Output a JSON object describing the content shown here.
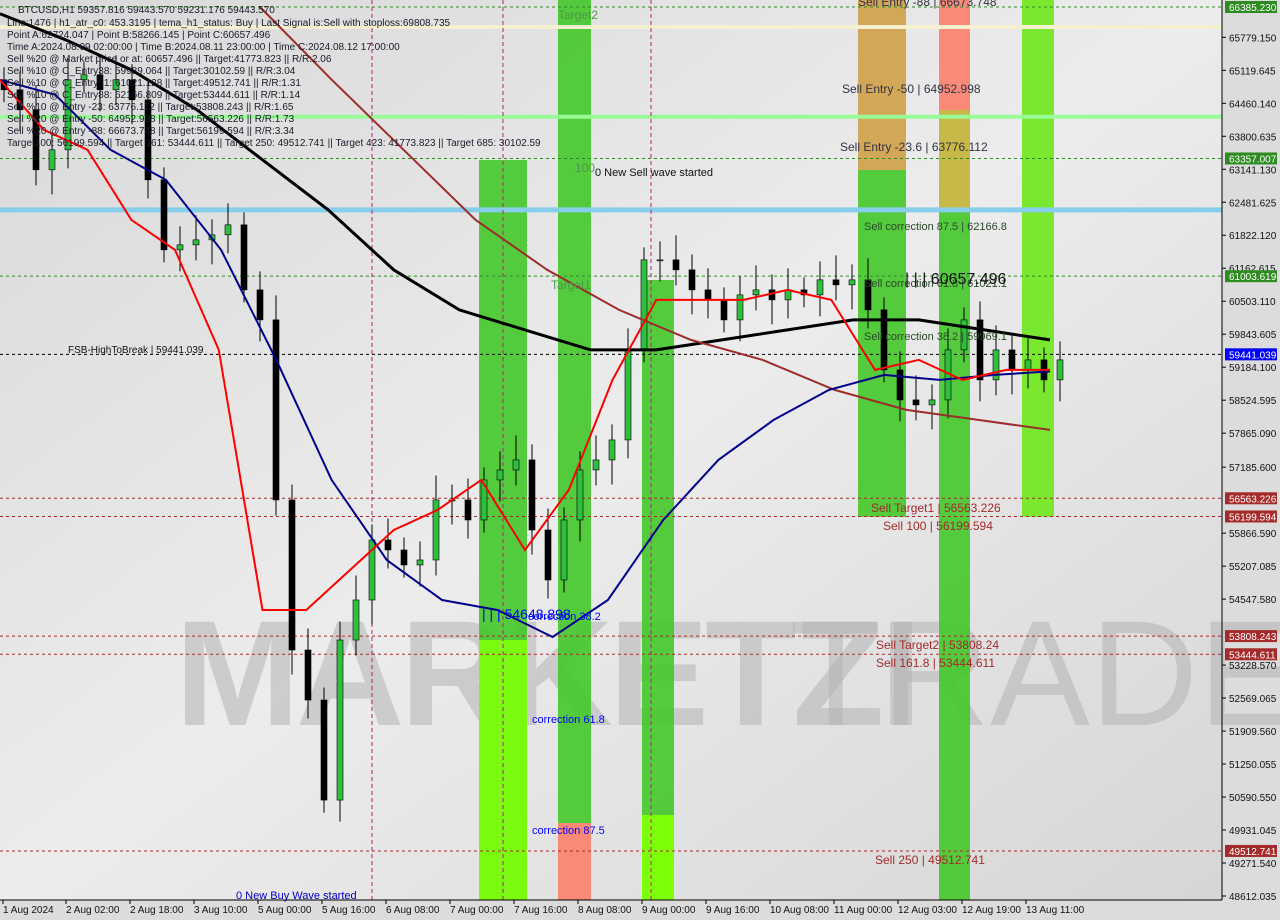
{
  "header": {
    "symbol_line": "BTCUSD,H1  59357.816 59443.570 59231.176 59443.570",
    "info_lines": [
      "Line:1476 | h1_atr_c0: 453.3195 | tema_h1_status: Buy | Last Signal is:Sell with stoploss:69808.735",
      "Point A:62724.047 | Point B:58266.145 | Point C:60657.496",
      "Time A:2024.08.09 02:00:00 | Time B:2024.08.11 23:00:00 | Time C:2024.08.12 17:00:00",
      "Sell %20 @ Market price or at: 60657.496 || Target:41773.823 || R/R:2.06",
      "Sell %10 @ C_Entry38: 59989.064 || Target:30102.59 || R/R:3.04",
      "Sell %10 @ C_Entry61: 61021.128 || Target:49512.741 || R/R:1.31",
      "Sell %10 @ C_Entry88: 62166.809 || Target:53444.611 || R/R:1.14",
      "Sell %10 @ Entry -23: 63776.112 || Target:53808.243 || R/R:1.65",
      "Sell %20 @ Entry -50: 64952.998 || Target:56563.226 || R/R:1.73",
      "Sell %20 @ Entry -88: 66673.748 || Target:56199.594 || R/R:3.34",
      "Target100: 56199.594 || Target 161: 53444.611 || Target 250: 49512.741 || Target 423: 41773.823 || Target 685: 30102.59"
    ]
  },
  "watermark": {
    "left": "MARKETZI",
    "right": "TRADE"
  },
  "annotations": {
    "sell_entry_88": "Sell Entry -88 | 66673.748",
    "sell_entry_50": "Sell Entry -50 | 64952.998",
    "sell_entry_23": "Sell Entry -23.6 | 63776.112",
    "sell_corr_875": "Sell correction 87.5 | 62166.8",
    "sell_corr_618": "Sell correction 61.8 | 61021.1",
    "sell_corr_382": "Sell correction 38.2 | 59969.1",
    "point_c": "| | | 60657.496",
    "point_low": "| | | 54648.898",
    "target2": "Target2",
    "target1": "Target1",
    "hundred": "100",
    "new_sell": "0 New Sell wave started",
    "new_buy": "0 New Buy Wave started",
    "fsb": "FSB-HighToBreak | 59441.039",
    "sell_target1": "Sell Target1 | 56563.226",
    "sell_100": "Sell 100 | 56199.594",
    "sell_target2": "Sell Target2 | 53808.24",
    "sell_1618": "Sell 161.8 | 53444.611",
    "sell_250": "Sell  250 | 49512.741",
    "corr_382": "correction 38.2",
    "corr_618": "correction 61.8",
    "corr_875": "correction 87.5"
  },
  "chart_data": {
    "type": "candlestick",
    "symbol": "BTCUSD",
    "timeframe": "H1",
    "ylim": [
      48612.035,
      66385.23
    ],
    "y_ticks": [
      "65779.150",
      "65119.645",
      "64460.140",
      "63800.635",
      "63141.130",
      "62481.625",
      "61822.120",
      "61162.615",
      "60503.110",
      "59843.605",
      "59184.100",
      "58524.595",
      "57865.090",
      "57185.600",
      "55866.590",
      "55207.085",
      "54547.580",
      "53228.570",
      "52569.065",
      "51909.560",
      "51250.055",
      "50590.550",
      "49931.045",
      "49271.540",
      "48612.035"
    ],
    "y_tick_values": [
      65779.15,
      65119.645,
      64460.14,
      63800.635,
      63141.13,
      62481.625,
      61822.12,
      61162.615,
      60503.11,
      59843.605,
      59184.1,
      58524.595,
      57865.09,
      57185.6,
      55866.59,
      55207.085,
      54547.58,
      53228.57,
      52569.065,
      51909.56,
      51250.055,
      50590.55,
      49931.045,
      49271.54,
      48612.035
    ],
    "x_ticks": [
      "1 Aug 2024",
      "2 Aug 02:00",
      "2 Aug 18:00",
      "3 Aug 10:00",
      "5 Aug 00:00",
      "5 Aug 16:00",
      "6 Aug 08:00",
      "7 Aug 00:00",
      "7 Aug 16:00",
      "8 Aug 08:00",
      "9 Aug 00:00",
      "9 Aug 16:00",
      "10 Aug 08:00",
      "11 Aug 00:00",
      "12 Aug 03:00",
      "12 Aug 19:00",
      "13 Aug 11:00"
    ],
    "price_tags": [
      {
        "text": "66385.230",
        "value": 66385.23,
        "color": "#2e8b22"
      },
      {
        "text": "63357.007",
        "value": 63357.007,
        "color": "#2e8b22"
      },
      {
        "text": "61003.619",
        "value": 61003.619,
        "color": "#2e8b22"
      },
      {
        "text": "59441.039",
        "value": 59441.039,
        "color": "#0000ff"
      },
      {
        "text": "56563.226",
        "value": 56563.226,
        "color": "#a52a2a"
      },
      {
        "text": "56199.594",
        "value": 56199.594,
        "color": "#a52a2a"
      },
      {
        "text": "53808.243",
        "value": 53808.243,
        "color": "#a52a2a"
      },
      {
        "text": "53444.611",
        "value": 53444.611,
        "color": "#a52a2a"
      },
      {
        "text": "49512.741",
        "value": 49512.741,
        "color": "#a52a2a"
      }
    ],
    "closes": [
      64730,
      64330,
      63130,
      63530,
      64930,
      65030,
      64730,
      64930,
      64530,
      62930,
      61530,
      61630,
      61730,
      61830,
      62030,
      60730,
      60130,
      56530,
      53530,
      52530,
      50530,
      53730,
      54530,
      55730,
      55530,
      55230,
      55330,
      56530,
      56530,
      56130,
      56930,
      57130,
      57330,
      55930,
      54930,
      56130,
      57130,
      57330,
      57730,
      59530,
      61330,
      61330,
      61130,
      60730,
      60530,
      60130,
      60630,
      60730,
      60530,
      60730,
      60630,
      60930,
      60830,
      60930,
      60330,
      59130,
      58530,
      58430,
      58530,
      59530,
      60130,
      58930,
      59530,
      59130,
      59330,
      58930,
      59330
    ],
    "series": [
      {
        "color": "#000000",
        "values": [
          66250,
          65730,
          65130,
          64330,
          63330,
          62330,
          61130,
          60330,
          59930,
          59530,
          59530,
          59730,
          59930,
          60130,
          60130,
          59930,
          59730
        ]
      },
      {
        "color": "#9b2d2a",
        "values": [
          66385,
          64930,
          63530,
          62130,
          61130,
          60330,
          59730,
          59330,
          58730,
          58330,
          58130,
          57930
        ]
      },
      {
        "color": "#00008b",
        "values": [
          64930,
          64630,
          63530,
          62930,
          61530,
          59330,
          56930,
          55330,
          54530,
          54330,
          53790,
          54530,
          56130,
          57330,
          58130,
          58730,
          59030,
          58930,
          59030,
          59100
        ]
      },
      {
        "color": "#ff0000",
        "values": [
          64930,
          63930,
          63530,
          62130,
          61530,
          59530,
          54330,
          54330,
          55130,
          55930,
          56330,
          56930,
          55530,
          56730,
          58930,
          60530,
          60530,
          60530,
          60730,
          60530,
          59130,
          59330,
          58930,
          59130,
          59130
        ]
      }
    ],
    "horizontal_levels": [
      {
        "value": 66385.23,
        "style": "dashed",
        "color": "#2e8b22"
      },
      {
        "value": 65985,
        "style": "solid",
        "color": "#f5f0d0"
      },
      {
        "value": 64190,
        "style": "solid",
        "color": "#98fb98"
      },
      {
        "value": 63357.007,
        "style": "dashed",
        "color": "#2e8b22"
      },
      {
        "value": 62330,
        "style": "solid",
        "color": "#87ceeb"
      },
      {
        "value": 61003.619,
        "style": "dashed",
        "color": "#2e8b22"
      },
      {
        "value": 59441.039,
        "style": "dashed",
        "color": "#000000"
      },
      {
        "value": 56563.226,
        "style": "dashed",
        "color": "#a52a2a"
      },
      {
        "value": 56199.594,
        "style": "dashed",
        "color": "#a52a2a"
      },
      {
        "value": 53808.243,
        "style": "dashed",
        "color": "#a52a2a"
      },
      {
        "value": 53444.611,
        "style": "dashed",
        "color": "#a52a2a"
      },
      {
        "value": 49512.741,
        "style": "dashed",
        "color": "#a52a2a"
      }
    ],
    "grid": false
  }
}
